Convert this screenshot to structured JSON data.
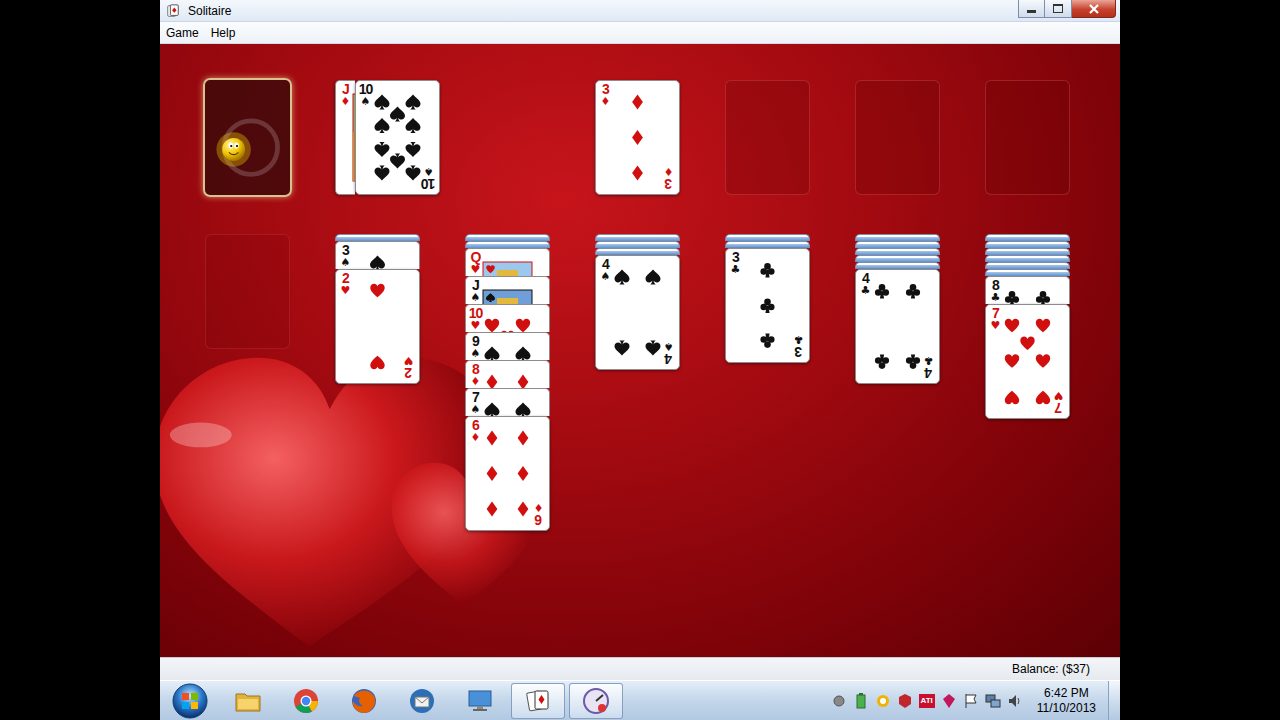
{
  "window": {
    "title": "Solitaire"
  },
  "menu": [
    {
      "label": "Game"
    },
    {
      "label": "Help"
    }
  ],
  "stock": {
    "empty": true
  },
  "waste": [
    {
      "rank": "J",
      "suit": "♦"
    },
    {
      "rank": "10",
      "suit": "♠"
    }
  ],
  "foundations": [
    {
      "top": {
        "rank": "3",
        "suit": "♦"
      }
    },
    {
      "top": null
    },
    {
      "top": null
    },
    {
      "top": null
    }
  ],
  "tableau": [
    {
      "hidden": 0,
      "cards": []
    },
    {
      "hidden": 1,
      "cards": [
        {
          "rank": "3",
          "suit": "♠"
        },
        {
          "rank": "2",
          "suit": "♥"
        }
      ]
    },
    {
      "hidden": 2,
      "cards": [
        {
          "rank": "Q",
          "suit": "♥"
        },
        {
          "rank": "J",
          "suit": "♠"
        },
        {
          "rank": "10",
          "suit": "♥"
        },
        {
          "rank": "9",
          "suit": "♠"
        },
        {
          "rank": "8",
          "suit": "♦"
        },
        {
          "rank": "7",
          "suit": "♠"
        },
        {
          "rank": "6",
          "suit": "♦"
        }
      ]
    },
    {
      "hidden": 3,
      "cards": [
        {
          "rank": "4",
          "suit": "♠"
        }
      ]
    },
    {
      "hidden": 2,
      "cards": [
        {
          "rank": "3",
          "suit": "♣"
        }
      ]
    },
    {
      "hidden": 5,
      "cards": [
        {
          "rank": "4",
          "suit": "♣"
        }
      ]
    },
    {
      "hidden": 6,
      "cards": [
        {
          "rank": "8",
          "suit": "♣"
        },
        {
          "rank": "7",
          "suit": "♥"
        }
      ]
    }
  ],
  "status_bar": {
    "balance": "Balance: ($37)"
  },
  "taskbar": {
    "apps": [
      {
        "kind": "explorer",
        "selected": false
      },
      {
        "kind": "chrome",
        "selected": false
      },
      {
        "kind": "firefox",
        "selected": false
      },
      {
        "kind": "thunderbird",
        "selected": false
      },
      {
        "kind": "display",
        "selected": false
      },
      {
        "kind": "solitaire",
        "selected": true
      },
      {
        "kind": "gauge",
        "selected": true
      }
    ],
    "tray": [
      {
        "kind": "dot"
      },
      {
        "kind": "battery"
      },
      {
        "kind": "ring"
      },
      {
        "kind": "cube"
      },
      {
        "kind": "ati",
        "label": "ATI"
      },
      {
        "kind": "gem"
      },
      {
        "kind": "flag"
      },
      {
        "kind": "network"
      },
      {
        "kind": "volume"
      }
    ],
    "time": "6:42 PM",
    "date": "11/10/2013"
  }
}
